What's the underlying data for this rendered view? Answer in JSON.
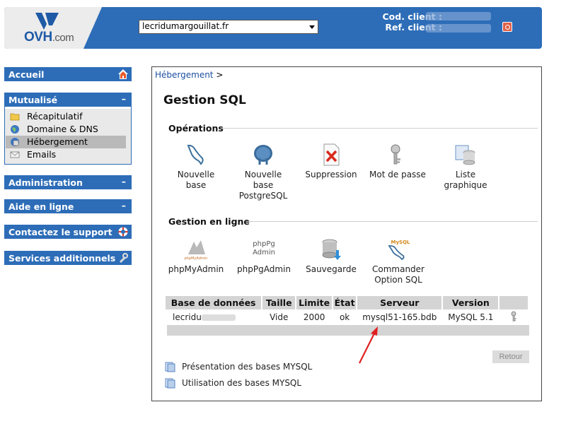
{
  "header": {
    "logo_text": "OVH",
    "logo_suffix": ".com",
    "domain_select_value": "lecridumargouillat.fr",
    "cod_client_label": "Cod. client :",
    "ref_client_label": "Ref. client :"
  },
  "sidebar": {
    "accueil": "Accueil",
    "mutualise": "Mutualisé",
    "mutualise_items": [
      {
        "label": "Récapitulatif",
        "icon": "folder-icon"
      },
      {
        "label": "Domaine & DNS",
        "icon": "globe-icon"
      },
      {
        "label": "Hébergement",
        "icon": "hosting-icon",
        "active": true
      },
      {
        "label": "Emails",
        "icon": "mail-icon"
      }
    ],
    "administration": "Administration",
    "aide": "Aide en ligne",
    "support": "Contactez le support",
    "services": "Services additionnels"
  },
  "breadcrumb": {
    "link": "Hébergement",
    "separator": ">"
  },
  "page_title": "Gestion SQL",
  "operations": {
    "title": "Opérations",
    "items": [
      {
        "line1": "Nouvelle",
        "line2": "base",
        "line3": ""
      },
      {
        "line1": "Nouvelle",
        "line2": "base",
        "line3": "PostgreSQL"
      },
      {
        "line1": "Suppression",
        "line2": "",
        "line3": ""
      },
      {
        "line1": "Mot de passe",
        "line2": "",
        "line3": ""
      },
      {
        "line1": "Liste",
        "line2": "graphique",
        "line3": ""
      }
    ]
  },
  "online": {
    "title": "Gestion en ligne",
    "items": [
      {
        "line1": "phpMyAdmin",
        "line2": ""
      },
      {
        "line1": "phpPgAdmin",
        "line2": ""
      },
      {
        "line1": "Sauvegarde",
        "line2": ""
      },
      {
        "line1": "Commander",
        "line2": "Option SQL"
      }
    ],
    "pma_logo_text": "phpMyAdmin",
    "ppa_logo_line1": "phpPg",
    "ppa_logo_line2": "Admin",
    "mysql_logo_text": "MySQL"
  },
  "table": {
    "headers": [
      "Base de données",
      "Taille",
      "Limite",
      "État",
      "Serveur",
      "Version"
    ],
    "rows": [
      {
        "name": "lecridu",
        "taille": "Vide",
        "limite": "2000",
        "etat": "ok",
        "serveur": "mysql51-165.bdb",
        "version": "MySQL 5.1"
      }
    ]
  },
  "retour_label": "Retour",
  "doc_links": [
    "Présentation des bases MYSQL",
    "Utilisation des bases MYSQL"
  ],
  "colors": {
    "brand": "#2d6db8",
    "accent_red": "#e02020"
  }
}
